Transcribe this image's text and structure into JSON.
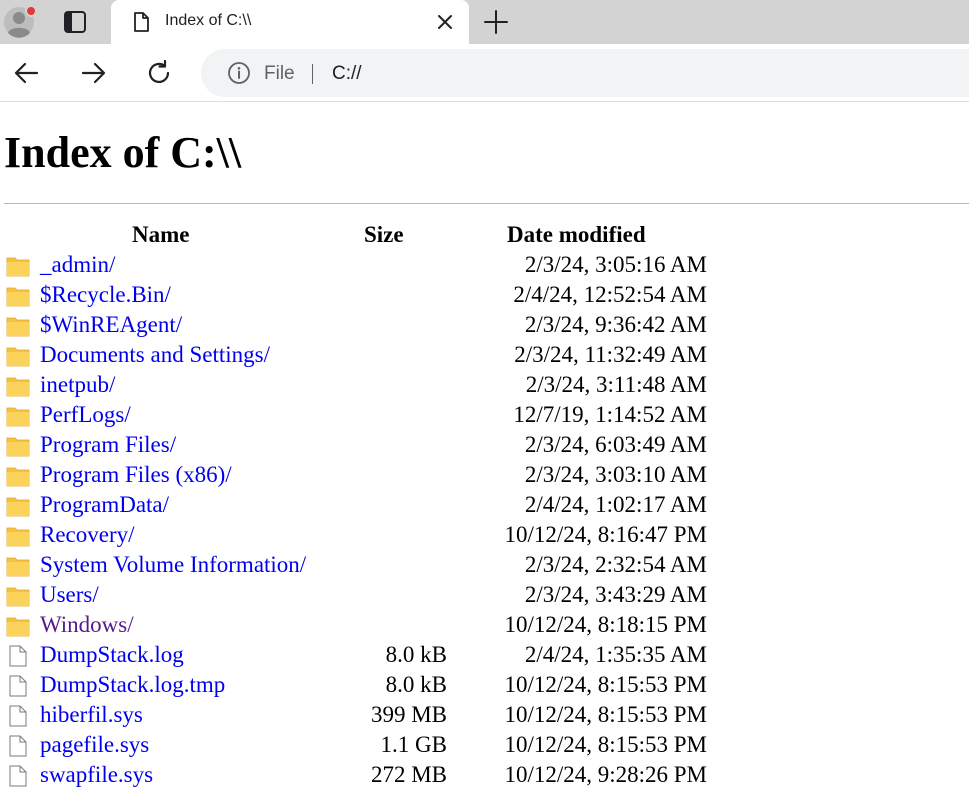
{
  "browser": {
    "tab_title": "Index of C:\\\\",
    "omnibox_chip": "File",
    "url": "C://"
  },
  "page": {
    "title": "Index of C:\\\\",
    "columns": {
      "name": "Name",
      "size": "Size",
      "date": "Date modified"
    },
    "rows": [
      {
        "type": "folder",
        "name": "_admin/",
        "size": "",
        "date": "2/3/24, 3:05:16 AM",
        "visited": false
      },
      {
        "type": "folder",
        "name": "$Recycle.Bin/",
        "size": "",
        "date": "2/4/24, 12:52:54 AM",
        "visited": false
      },
      {
        "type": "folder",
        "name": "$WinREAgent/",
        "size": "",
        "date": "2/3/24, 9:36:42 AM",
        "visited": false
      },
      {
        "type": "folder",
        "name": "Documents and Settings/",
        "size": "",
        "date": "2/3/24, 11:32:49 AM",
        "visited": false
      },
      {
        "type": "folder",
        "name": "inetpub/",
        "size": "",
        "date": "2/3/24, 3:11:48 AM",
        "visited": false
      },
      {
        "type": "folder",
        "name": "PerfLogs/",
        "size": "",
        "date": "12/7/19, 1:14:52 AM",
        "visited": false
      },
      {
        "type": "folder",
        "name": "Program Files/",
        "size": "",
        "date": "2/3/24, 6:03:49 AM",
        "visited": false
      },
      {
        "type": "folder",
        "name": "Program Files (x86)/",
        "size": "",
        "date": "2/3/24, 3:03:10 AM",
        "visited": false
      },
      {
        "type": "folder",
        "name": "ProgramData/",
        "size": "",
        "date": "2/4/24, 1:02:17 AM",
        "visited": false
      },
      {
        "type": "folder",
        "name": "Recovery/",
        "size": "",
        "date": "10/12/24, 8:16:47 PM",
        "visited": false
      },
      {
        "type": "folder",
        "name": "System Volume Information/",
        "size": "",
        "date": "2/3/24, 2:32:54 AM",
        "visited": false
      },
      {
        "type": "folder",
        "name": "Users/",
        "size": "",
        "date": "2/3/24, 3:43:29 AM",
        "visited": false
      },
      {
        "type": "folder",
        "name": "Windows/",
        "size": "",
        "date": "10/12/24, 8:18:15 PM",
        "visited": true
      },
      {
        "type": "file",
        "name": "DumpStack.log",
        "size": "8.0 kB",
        "date": "2/4/24, 1:35:35 AM",
        "visited": false
      },
      {
        "type": "file",
        "name": "DumpStack.log.tmp",
        "size": "8.0 kB",
        "date": "10/12/24, 8:15:53 PM",
        "visited": false
      },
      {
        "type": "file",
        "name": "hiberfil.sys",
        "size": "399 MB",
        "date": "10/12/24, 8:15:53 PM",
        "visited": false
      },
      {
        "type": "file",
        "name": "pagefile.sys",
        "size": "1.1 GB",
        "date": "10/12/24, 8:15:53 PM",
        "visited": false
      },
      {
        "type": "file",
        "name": "swapfile.sys",
        "size": "272 MB",
        "date": "10/12/24, 9:28:26 PM",
        "visited": false
      }
    ]
  },
  "colors": {
    "link": "#0000ee",
    "visited_link": "#551a8b",
    "folder_icon": "#f5c242",
    "tabstrip_bg": "#d3d3d3",
    "omnibox_bg": "#f1f3f4",
    "profile_badge": "#e53935"
  },
  "icons": {
    "profile": "profile-avatar-icon",
    "tab_actions": "tab-actions-icon",
    "favicon": "page-icon",
    "close": "close-icon",
    "new_tab": "plus-icon",
    "back": "arrow-left-icon",
    "forward": "arrow-right-icon",
    "reload": "reload-icon",
    "site_info": "info-icon",
    "folder": "folder-icon",
    "file": "file-icon"
  }
}
